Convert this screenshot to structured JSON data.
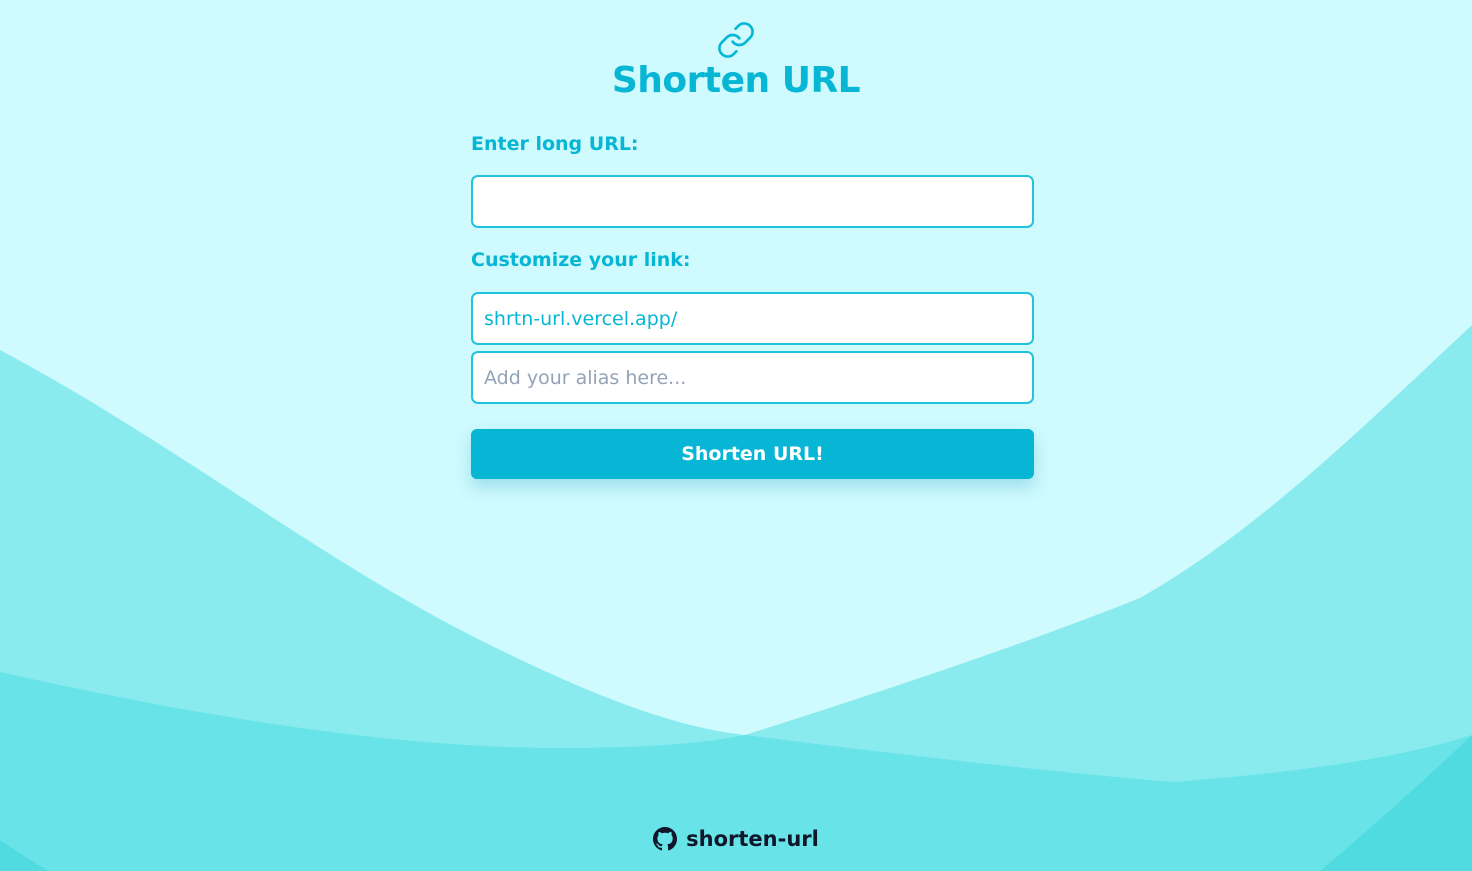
{
  "app": {
    "title": "Shorten URL",
    "icon": "link-icon"
  },
  "form": {
    "long_url_label": "Enter long URL:",
    "long_url_value": "",
    "customize_label": "Customize your link:",
    "domain_prefix": "shrtn-url.vercel.app/",
    "alias_placeholder": "Add your alias here...",
    "alias_value": "",
    "submit_label": "Shorten URL!"
  },
  "footer": {
    "repo_label": "shorten-url",
    "icon": "github-icon"
  },
  "colors": {
    "background": "#cffafe",
    "accent": "#06b6d4",
    "wave_light": "#8aebef",
    "wave_mid": "#68e3e8",
    "wave_dark": "#4fdbe0",
    "footer_text": "#0f172a"
  }
}
